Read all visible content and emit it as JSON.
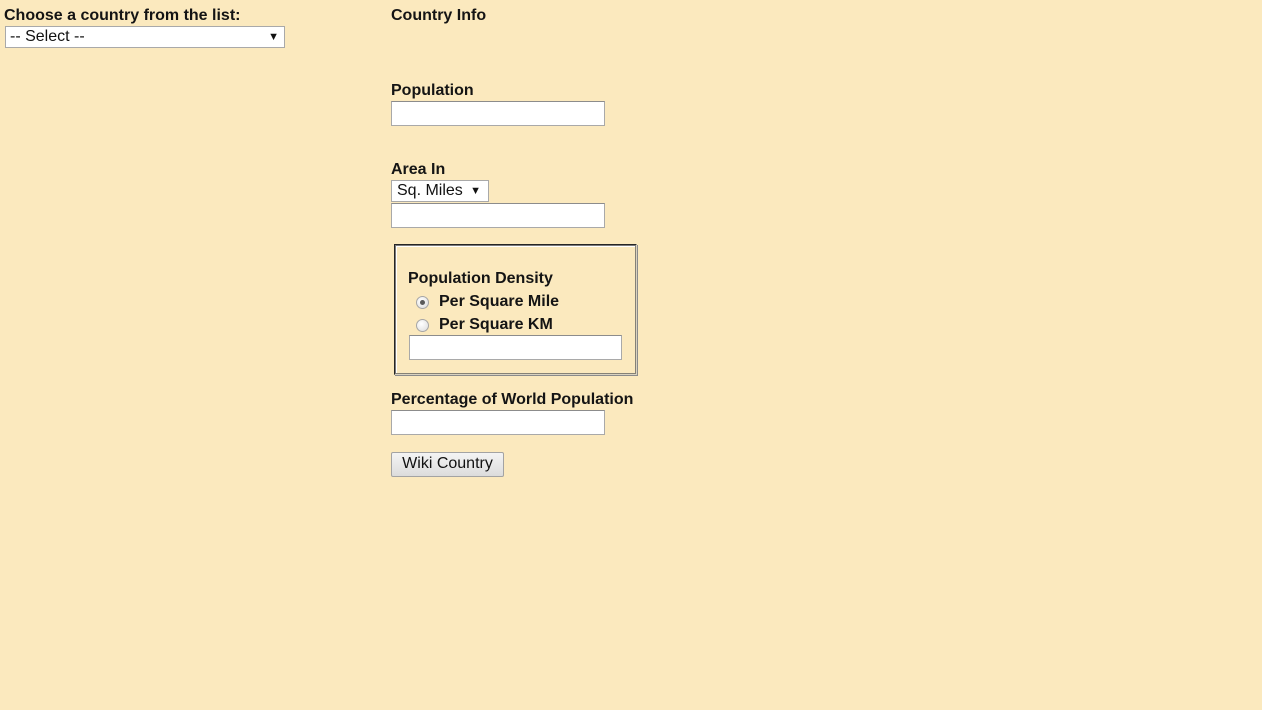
{
  "country_picker": {
    "label": "Choose a country from the list:",
    "selected": "-- Select --"
  },
  "info": {
    "heading": "Country Info",
    "population": {
      "label": "Population",
      "value": ""
    },
    "area": {
      "label": "Area In",
      "unit_selected": "Sq. Miles",
      "value": ""
    },
    "density": {
      "label": "Population Density",
      "options": [
        {
          "label": "Per Square Mile",
          "checked": true
        },
        {
          "label": "Per Square KM",
          "checked": false
        }
      ],
      "value": ""
    },
    "world_percentage": {
      "label": "Percentage of World Population",
      "value": ""
    },
    "wiki_button": "Wiki Country"
  }
}
